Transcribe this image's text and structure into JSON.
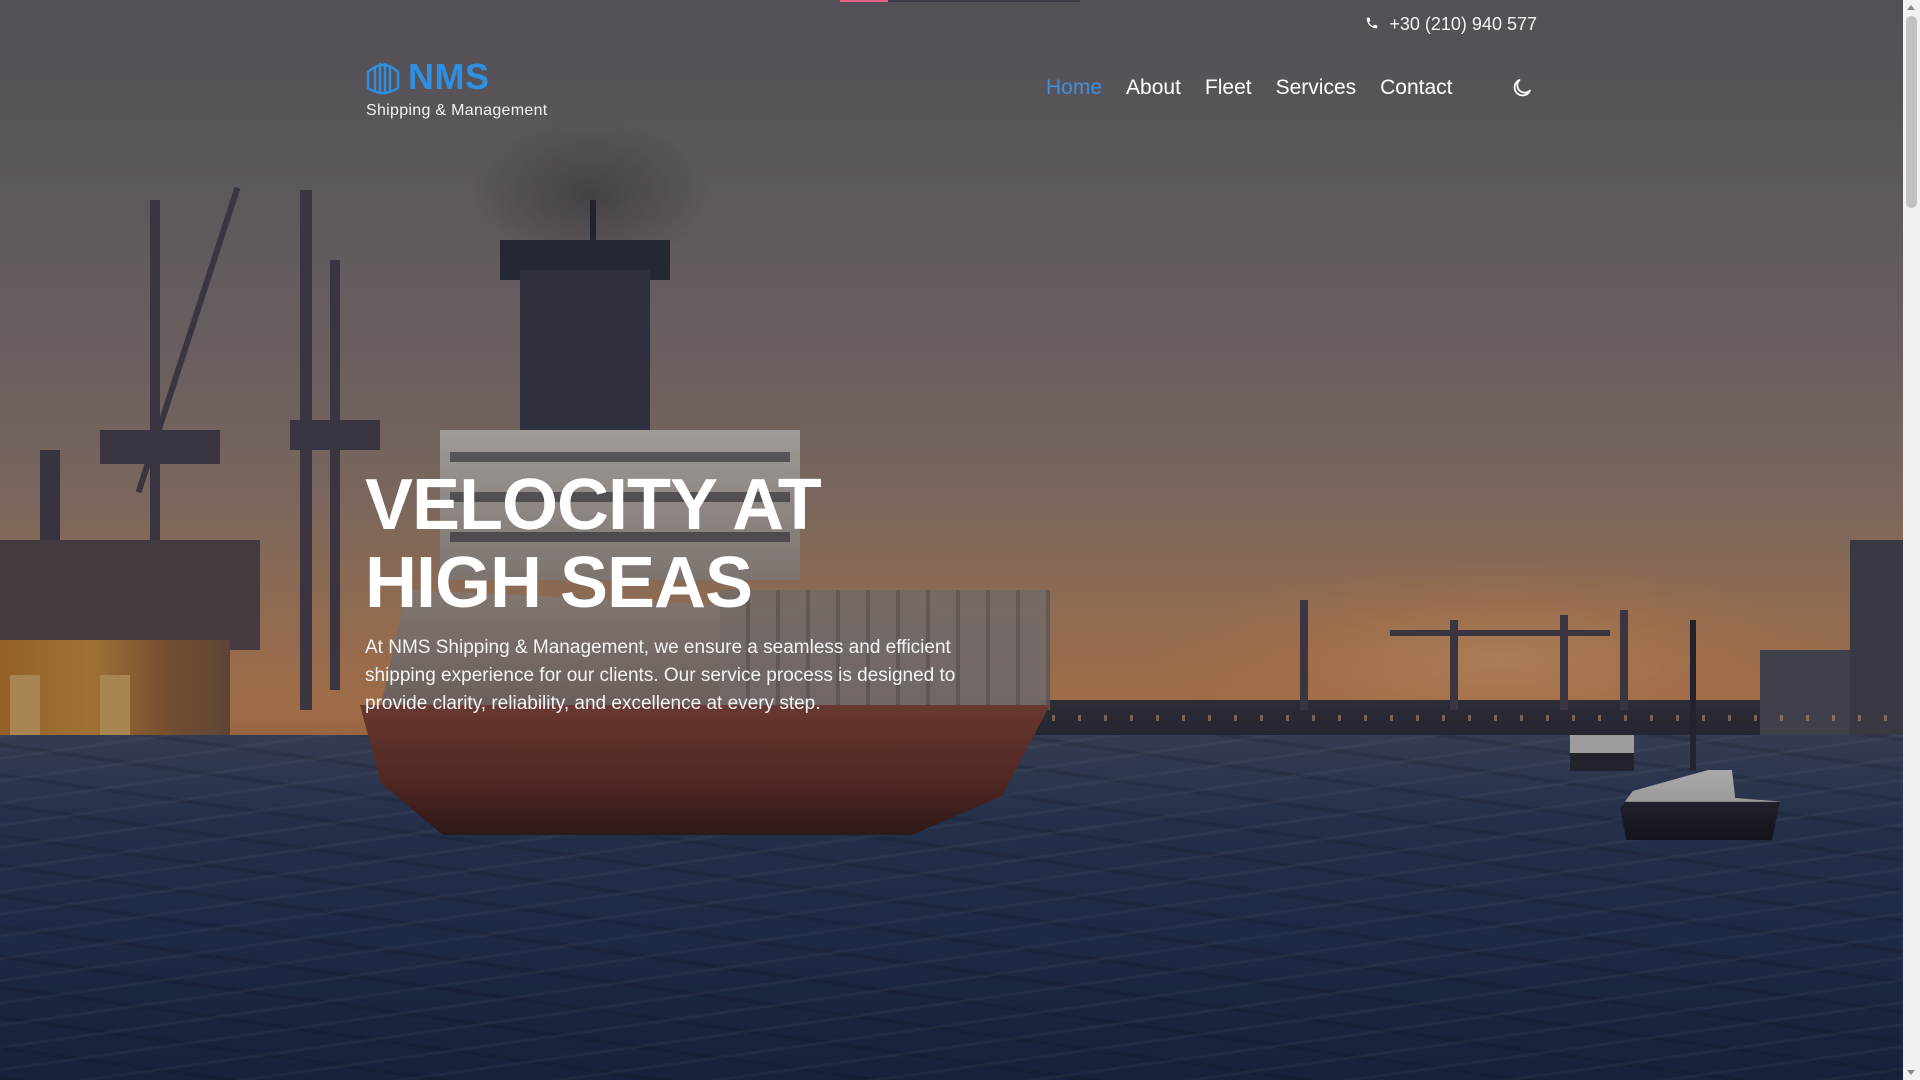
{
  "header": {
    "phone": "+30 (210) 940 577",
    "logo": {
      "name": "NMS",
      "tagline": "Shipping & Management"
    },
    "nav": [
      {
        "label": "Home",
        "active": true
      },
      {
        "label": "About",
        "active": false
      },
      {
        "label": "Fleet",
        "active": false
      },
      {
        "label": "Services",
        "active": false
      },
      {
        "label": "Contact",
        "active": false
      }
    ],
    "theme_toggle_icon": "moon-icon"
  },
  "hero": {
    "title": "VELOCITY AT HIGH SEAS",
    "text": "At NMS Shipping & Management, we ensure a seamless and efficient shipping experience for our clients. Our service process is designed to provide clarity, reliability, and excellence at every step."
  },
  "colors": {
    "brand_blue": "#2f8fe0",
    "active_nav": "#3e90dc",
    "progress_accent": "#e6668a"
  },
  "top_progress": {
    "fraction": 0.2
  }
}
